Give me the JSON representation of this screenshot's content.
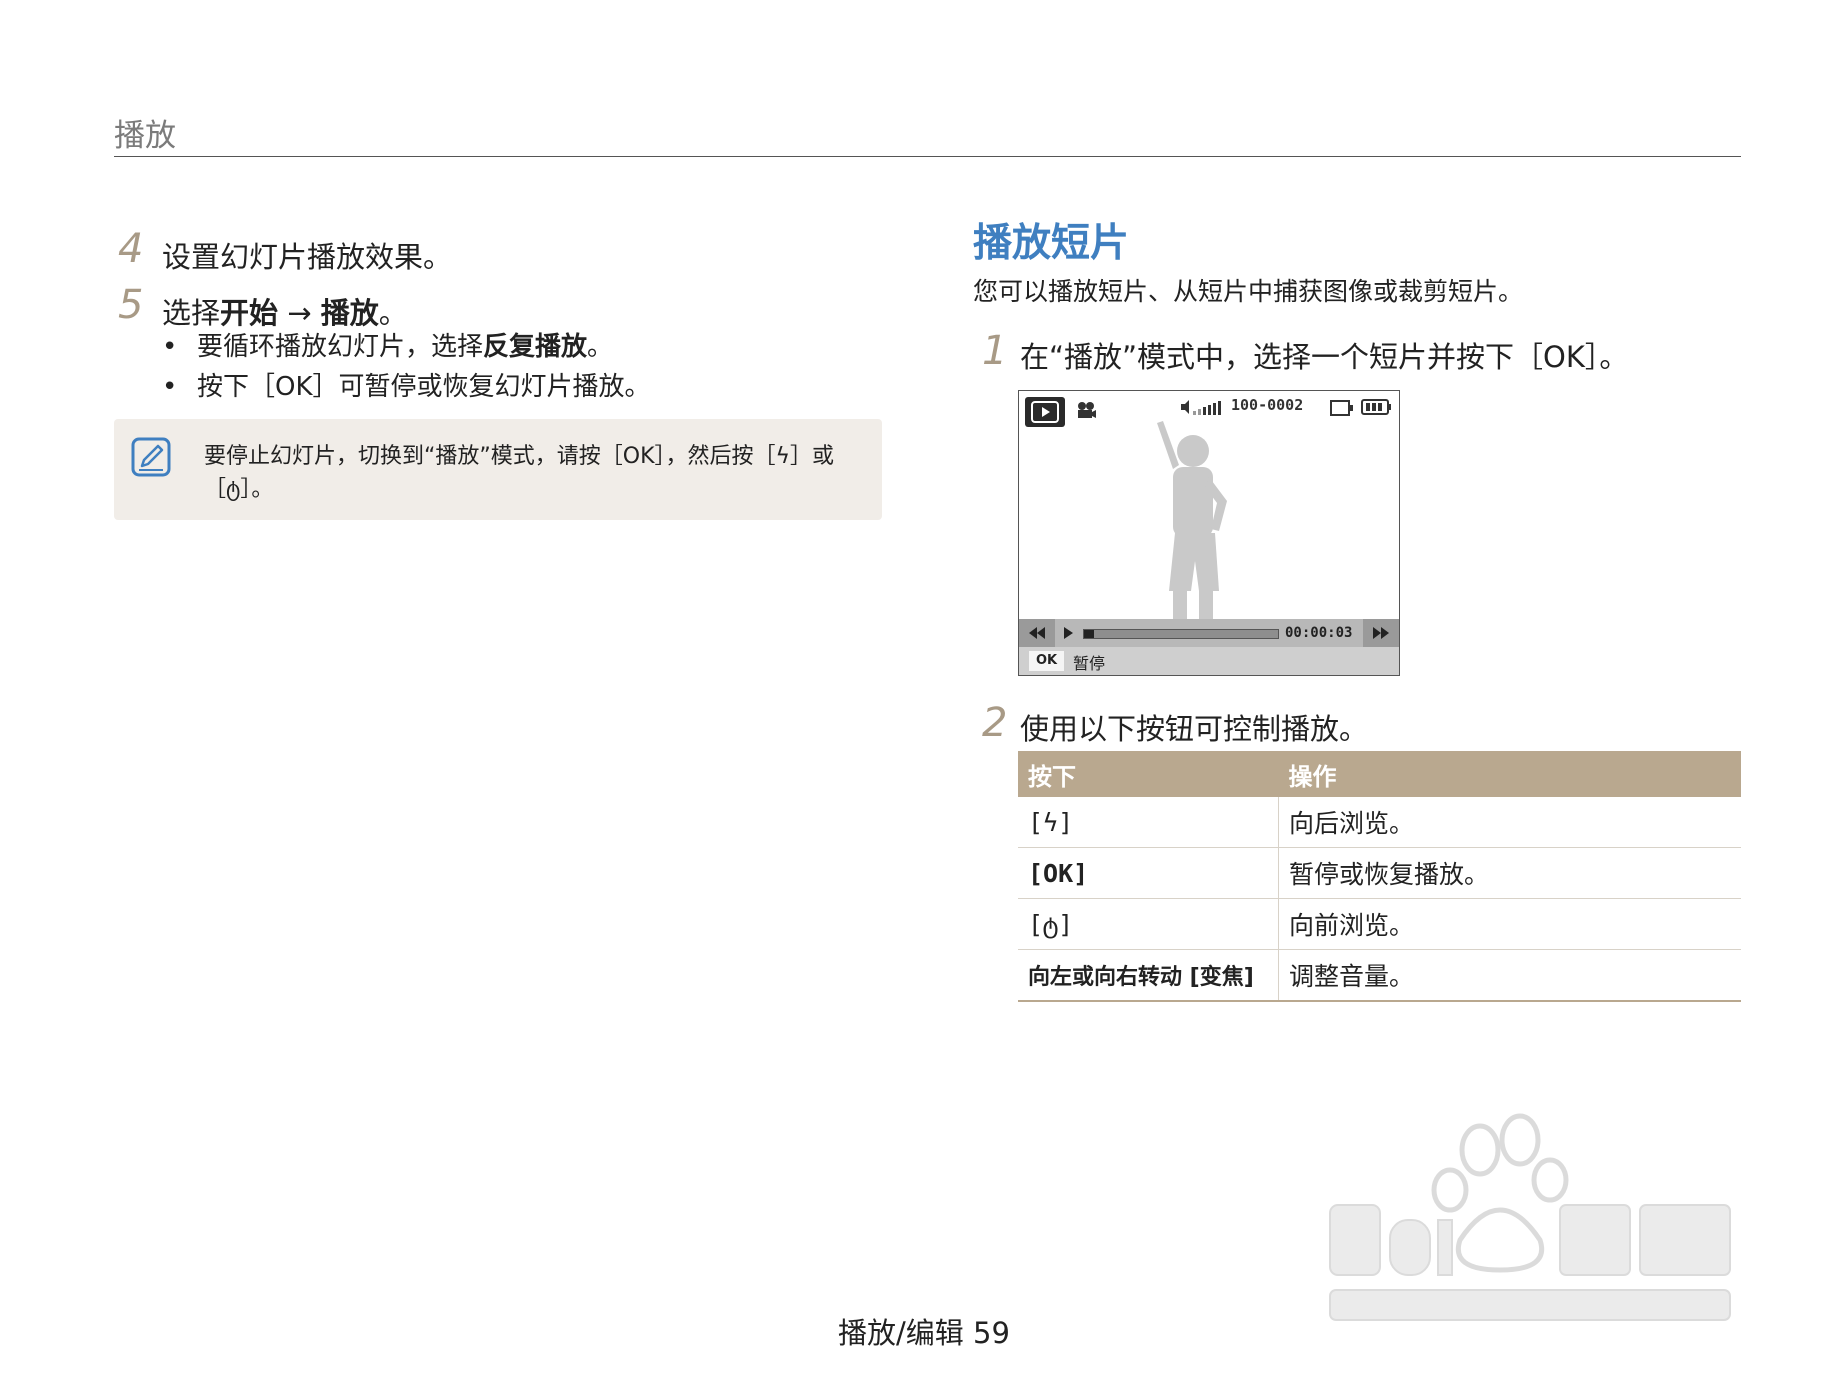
{
  "header": {
    "title": "播放"
  },
  "left": {
    "step4": {
      "num": "4",
      "text": "设置幻灯片播放效果。"
    },
    "step5": {
      "num": "5",
      "prefix": "选择",
      "bold1": "开始",
      "arrow": " → ",
      "bold2": "播放",
      "suffix": "。",
      "bullets": [
        {
          "prefix": "要循环播放幻灯片，选择",
          "bold": "反复播放",
          "suffix": "。"
        },
        {
          "text": "按下［OK］可暂停或恢复幻灯片播放。"
        }
      ]
    },
    "note": {
      "line1": "要停止幻灯片，切换到“播放”模式，请按［OK］，然后按［ϟ］或",
      "line2": "［ტ］。"
    }
  },
  "right": {
    "title": "播放短片",
    "intro": "您可以播放短片、从短片中捕获图像或裁剪短片。",
    "step1": {
      "num": "1",
      "text": "在“播放”模式中，选择一个短片并按下［OK］。"
    },
    "screen": {
      "file_number": "100-0002",
      "time": "00:00:03",
      "ok_label": "OK",
      "pause_label": "暂停",
      "progress": 0.05
    },
    "step2": {
      "num": "2",
      "text": "使用以下按钮可控制播放。"
    },
    "table": {
      "headers": [
        "按下",
        "操作"
      ],
      "rows": [
        {
          "key": "[ϟ]",
          "action": "向后浏览。"
        },
        {
          "key": "[OK]",
          "action": "暂停或恢复播放。"
        },
        {
          "key": "[ტ]",
          "action": "向前浏览。"
        },
        {
          "key": "向左或向右转动 [变焦]",
          "action": "调整音量。"
        }
      ]
    }
  },
  "footer": {
    "text": "播放/编辑  59"
  },
  "colors": {
    "accent_blue": "#3f7fc0",
    "table_header": "#b9a88f",
    "note_bg": "#f1ede8",
    "step_num": "#a89a86"
  }
}
